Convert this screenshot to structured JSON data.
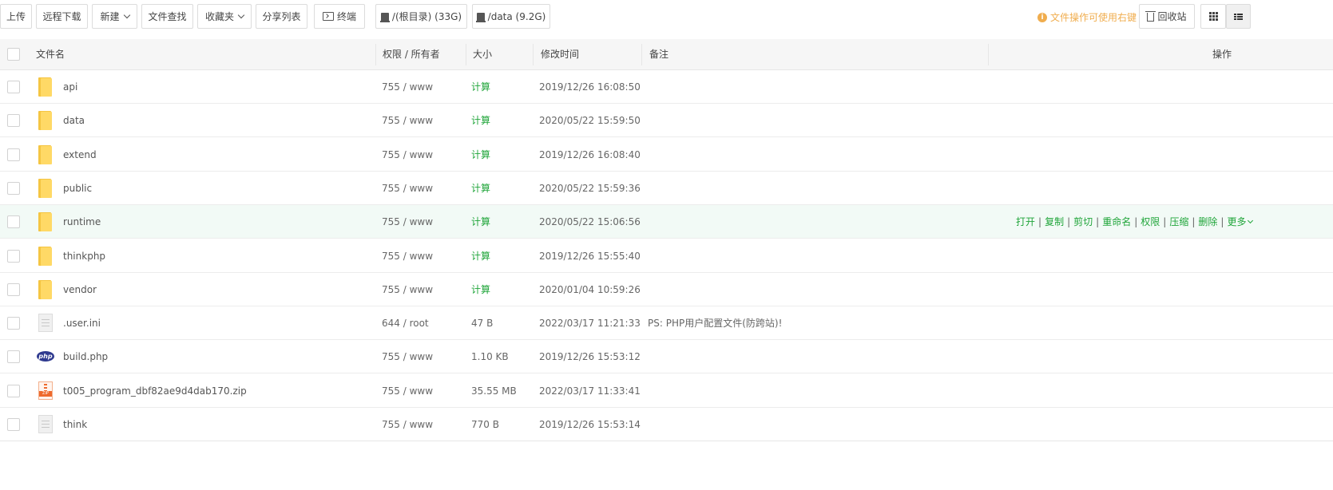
{
  "toolbar": {
    "upload": "上传",
    "remote_download": "远程下载",
    "new": "新建",
    "file_search": "文件查找",
    "favorites": "收藏夹",
    "share_list": "分享列表",
    "terminal": "终端",
    "disk_root": "/(根目录) (33G)",
    "disk_data": "/data (9.2G)",
    "tip": "文件操作可使用右键",
    "recycle_bin": "回收站"
  },
  "table": {
    "headers": {
      "name": "文件名",
      "perm": "权限 / 所有者",
      "size": "大小",
      "mtime": "修改时间",
      "note": "备注",
      "ops": "操作"
    },
    "rows": [
      {
        "name": "api",
        "type": "folder",
        "perm": "755 / www",
        "size": "计算",
        "mtime": "2019/12/26 16:08:50",
        "note": ""
      },
      {
        "name": "data",
        "type": "folder",
        "perm": "755 / www",
        "size": "计算",
        "mtime": "2020/05/22 15:59:50",
        "note": ""
      },
      {
        "name": "extend",
        "type": "folder",
        "perm": "755 / www",
        "size": "计算",
        "mtime": "2019/12/26 16:08:40",
        "note": ""
      },
      {
        "name": "public",
        "type": "folder",
        "perm": "755 / www",
        "size": "计算",
        "mtime": "2020/05/22 15:59:36",
        "note": ""
      },
      {
        "name": "runtime",
        "type": "folder",
        "perm": "755 / www",
        "size": "计算",
        "mtime": "2020/05/22 15:06:56",
        "note": ""
      },
      {
        "name": "thinkphp",
        "type": "folder",
        "perm": "755 / www",
        "size": "计算",
        "mtime": "2019/12/26 15:55:40",
        "note": ""
      },
      {
        "name": "vendor",
        "type": "folder",
        "perm": "755 / www",
        "size": "计算",
        "mtime": "2020/01/04 10:59:26",
        "note": ""
      },
      {
        "name": ".user.ini",
        "type": "text",
        "perm": "644 / root",
        "size": "47 B",
        "mtime": "2022/03/17 11:21:33",
        "note": "PS: PHP用户配置文件(防跨站)!"
      },
      {
        "name": "build.php",
        "type": "php",
        "perm": "755 / www",
        "size": "1.10 KB",
        "mtime": "2019/12/26 15:53:12",
        "note": ""
      },
      {
        "name": "t005_program_dbf82ae9d4dab170.zip",
        "type": "zip",
        "perm": "755 / www",
        "size": "35.55 MB",
        "mtime": "2022/03/17 11:33:41",
        "note": ""
      },
      {
        "name": "think",
        "type": "text",
        "perm": "755 / www",
        "size": "770 B",
        "mtime": "2019/12/26 15:53:14",
        "note": ""
      }
    ],
    "hover_row_index": 4,
    "row_actions": [
      "打开",
      "复制",
      "剪切",
      "重命名",
      "权限",
      "压缩",
      "删除",
      "更多"
    ]
  },
  "icons": {
    "folder": "folder-icon",
    "text": "text-file-icon",
    "php": "php-file-icon",
    "zip": "zip-file-icon"
  },
  "colors": {
    "accent_green": "#20a53a",
    "tip_orange": "#f0ad4e",
    "hover_row_bg": "#f2faf6"
  },
  "php_badge": "php"
}
